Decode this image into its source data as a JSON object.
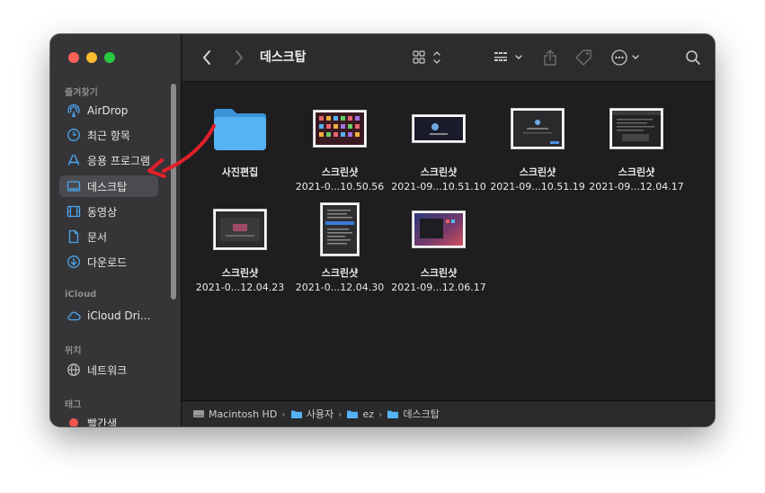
{
  "window": {
    "title": "데스크탑"
  },
  "sidebar": {
    "sections": [
      {
        "title": "즐겨찾기",
        "items": [
          {
            "label": "AirDrop",
            "icon": "airdrop-icon"
          },
          {
            "label": "최근 항목",
            "icon": "clock-icon"
          },
          {
            "label": "응용 프로그램",
            "icon": "applications-icon"
          },
          {
            "label": "데스크탑",
            "icon": "desktop-icon",
            "active": true
          },
          {
            "label": "동영상",
            "icon": "film-icon"
          },
          {
            "label": "문서",
            "icon": "document-icon"
          },
          {
            "label": "다운로드",
            "icon": "download-icon"
          }
        ]
      },
      {
        "title": "iCloud",
        "items": [
          {
            "label": "iCloud Dri...",
            "icon": "cloud-icon"
          }
        ]
      },
      {
        "title": "위치",
        "items": [
          {
            "label": "네트워크",
            "icon": "network-icon"
          }
        ]
      },
      {
        "title": "태그",
        "items": [
          {
            "label": "빨간색",
            "icon": "red-tag-icon"
          }
        ]
      }
    ]
  },
  "toolbar": {
    "back_icon": "chevron-left-icon",
    "forward_icon": "chevron-right-icon",
    "view_icon": "icon-grid-view-icon",
    "group_icon": "group-by-icon",
    "share_icon": "share-icon",
    "tag_icon": "tag-icon",
    "more_icon": "more-actions-icon",
    "search_icon": "search-icon"
  },
  "files": [
    {
      "name": "사진편집",
      "sub": "",
      "kind": "folder"
    },
    {
      "name": "스크린샷",
      "sub": "2021-0...10.50.56",
      "kind": "shot-colorful"
    },
    {
      "name": "스크린샷",
      "sub": "2021-09...10.51.10",
      "kind": "shot-dark-wide"
    },
    {
      "name": "스크린샷",
      "sub": "2021-09...10.51.19",
      "kind": "shot-dialog"
    },
    {
      "name": "스크린샷",
      "sub": "2021-09...12.04.17",
      "kind": "shot-window"
    },
    {
      "name": "스크린샷",
      "sub": "2021-0...12.04.23",
      "kind": "shot-app"
    },
    {
      "name": "스크린샷",
      "sub": "2021-0...12.04.30",
      "kind": "shot-menu"
    },
    {
      "name": "스크린샷",
      "sub": "2021-09...12.06.17",
      "kind": "shot-desktop"
    }
  ],
  "path_bar": [
    {
      "label": "Macintosh HD",
      "icon": "hard-drive-icon"
    },
    {
      "label": "사용자",
      "icon": "folder-icon"
    },
    {
      "label": "ez",
      "icon": "folder-icon"
    },
    {
      "label": "데스크탑",
      "icon": "folder-icon"
    }
  ],
  "path_separator": "›",
  "colors": {
    "accent": "#4aa8f0",
    "annotation_arrow": "#e0202a",
    "folder": "#55b3f3"
  }
}
